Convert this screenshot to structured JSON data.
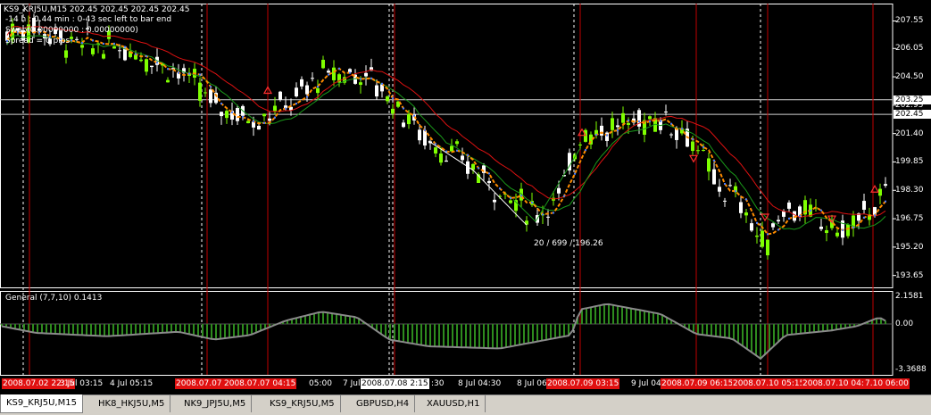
{
  "header": {
    "symbol_line": "KS9_KRJ5U,M15  202.45 202.45 202.45 202.45",
    "timer_line": "-14 h : 0.44 min : 0-43 sec left to bar end",
    "swap_line": "Swap(0.00000000 : 0.00000000)",
    "spread_line": "Spread = 0 pips"
  },
  "annotation": "20 / 699 / 196.26",
  "indicator": {
    "label": "General (7,7,10) 0.1413",
    "scale_labels": [
      "2.1581",
      "0.00",
      "-3.3688"
    ]
  },
  "price_axis": {
    "labels": [
      "207.55",
      "206.05",
      "204.50",
      "202.95",
      "201.40",
      "199.85",
      "198.30",
      "196.75",
      "195.20",
      "193.65"
    ],
    "current_price_boxes": [
      "203.25",
      "202.45"
    ]
  },
  "time_axis": [
    {
      "text": "2008.07.02 22:15",
      "style": "red"
    },
    {
      "text": "3 Jul 03:15",
      "style": "plain"
    },
    {
      "text": "4 Jul 05:15",
      "style": "plain"
    },
    {
      "text": "2008.07.07 02:15",
      "style": "red"
    },
    {
      "text": "2008.07.07 04:15",
      "style": "red"
    },
    {
      "text": "05:00",
      "style": "plain"
    },
    {
      "text": "7 Jul",
      "style": "plain"
    },
    {
      "text": "2008.07.08 2:15",
      "style": "white"
    },
    {
      "text": ":30",
      "style": "plain"
    },
    {
      "text": "8 Jul 04:30",
      "style": "plain"
    },
    {
      "text": "8 Jul 06:",
      "style": "plain"
    },
    {
      "text": "2008.07.09 03:15",
      "style": "red"
    },
    {
      "text": "9 Jul 04:",
      "style": "plain"
    },
    {
      "text": "2008.07.09 06:15",
      "style": "red"
    },
    {
      "text": "2008.07.10 05:15",
      "style": "red"
    },
    {
      "text": "2008.07.10 04:30",
      "style": "red"
    },
    {
      "text": "7.10 06:00",
      "style": "red"
    }
  ],
  "tabs": [
    {
      "label": "KS9_KRJ5U,M15",
      "active": true
    },
    {
      "label": "HK8_HKJ5U,M5",
      "active": false
    },
    {
      "label": "NK9_JPJ5U,M5",
      "active": false
    },
    {
      "label": "KS9_KRJ5U,M5",
      "active": false
    },
    {
      "label": "GBPUSD,H4",
      "active": false
    },
    {
      "label": "XAUUSD,H1",
      "active": false
    }
  ],
  "colors": {
    "background": "#000000",
    "bull_candle": "#7fff00",
    "bear_candle": "#ffffff",
    "ma_fast": "#ff8c00",
    "ma_dots": "#4a7cff",
    "ma_slow": "#dd1111",
    "ma_green": "#1a9a1a",
    "histogram": "#2e8b1e",
    "oscillator_line": "#8a8a8a",
    "vline_red": "#c00000",
    "vline_white_dashed": "#ffffff"
  }
}
